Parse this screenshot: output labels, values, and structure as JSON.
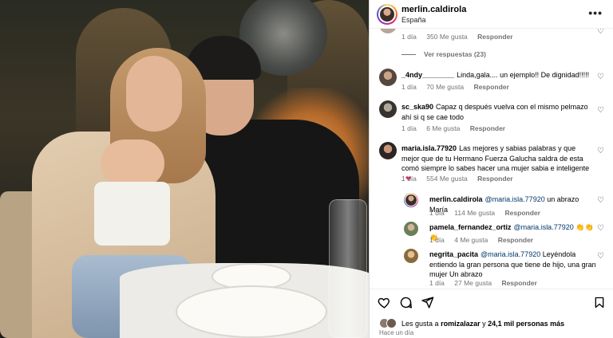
{
  "header": {
    "username": "merlin.caldirola",
    "location": "España",
    "more": "•••"
  },
  "top_meta": {
    "time": "1 día",
    "likes": "350 Me gusta",
    "reply": "Responder"
  },
  "view_replies": "Ver respuestas (23)",
  "comments": [
    {
      "user": "_4ndy________",
      "text": "Linda,gala.... un ejemplo!! De dignidad!!!!!",
      "time": "1 día",
      "likes": "70 Me gusta",
      "reply": "Responder"
    },
    {
      "user": "sc_ska90",
      "text": "Capaz q después vuelva con el mismo pelmazo ahí si q se cae todo",
      "time": "1 día",
      "likes": "6 Me gusta",
      "reply": "Responder"
    },
    {
      "user": "maria.isla.77920",
      "text": "Las mejores y sabias palabras y que mejor que de tu Hermano Fuerza Galucha saldra de esta comó siempre lo sabes hacer una mujer sabia e inteligente .",
      "emoji": "❤",
      "time": "1 día",
      "likes": "554 Me gusta",
      "reply": "Responder"
    }
  ],
  "replies": [
    {
      "user": "merlin.caldirola",
      "mention": "@maria.isla.77920",
      "text": "un abrazo María",
      "time": "1 día",
      "likes": "114 Me gusta",
      "reply": "Responder"
    },
    {
      "user": "pamela_fernandez_ortiz",
      "mention": "@maria.isla.77920",
      "text": "👏👏👏",
      "time": "1 día",
      "likes": "4 Me gusta",
      "reply": "Responder"
    },
    {
      "user": "negrita_pacita",
      "mention": "@maria.isla.77920",
      "text": "Leyéndola entiendo la gran persona que tiene de hijo, una gran mujer Un abrazo",
      "time": "1 día",
      "likes": "27 Me gusta",
      "reply": "Responder"
    }
  ],
  "footer": {
    "likes_prefix": "Les gusta a",
    "likes_user": "romizalazar",
    "likes_suffix": "y",
    "likes_count": "24,1 mil personas más",
    "ago": "Hace un día"
  },
  "icons": {
    "heart": "heart-icon",
    "comment": "comment-icon",
    "share": "share-icon",
    "save": "bookmark-icon"
  }
}
